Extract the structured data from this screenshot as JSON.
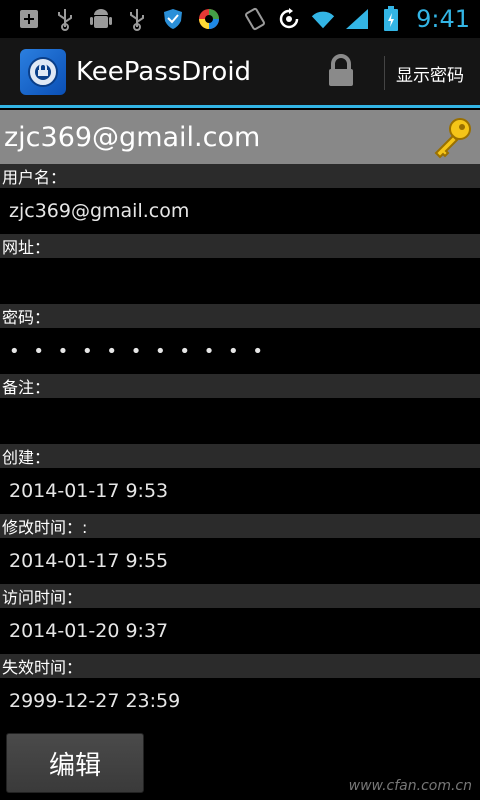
{
  "statusbar": {
    "time": "9:41",
    "icons": [
      "add-box-icon",
      "usb-icon",
      "android-debug-icon",
      "usb-icon",
      "shield-icon",
      "color-wheel-icon",
      "rotate-icon",
      "sync-icon",
      "wifi-icon",
      "signal-icon",
      "battery-icon"
    ],
    "accent": "#33b5e5"
  },
  "actionbar": {
    "title": "KeePassDroid",
    "show_password": "显示密码"
  },
  "entry": {
    "title": "zjc369@gmail.com"
  },
  "fields": [
    {
      "label": "用户名：",
      "value": "zjc369@gmail.com"
    },
    {
      "label": "网址：",
      "value": ""
    },
    {
      "label": "密码：",
      "value": "• • • • • • • • • • •"
    },
    {
      "label": "备注：",
      "value": ""
    },
    {
      "label": "创建：",
      "value": "2014-01-17 9:53"
    },
    {
      "label": "修改时间：:",
      "value": "2014-01-17 9:55"
    },
    {
      "label": "访问时间：",
      "value": "2014-01-20 9:37"
    },
    {
      "label": "失效时间：",
      "value": "2999-12-27 23:59"
    }
  ],
  "footer": {
    "edit_label": "编辑",
    "watermark": "www.cfan.com.cn"
  }
}
